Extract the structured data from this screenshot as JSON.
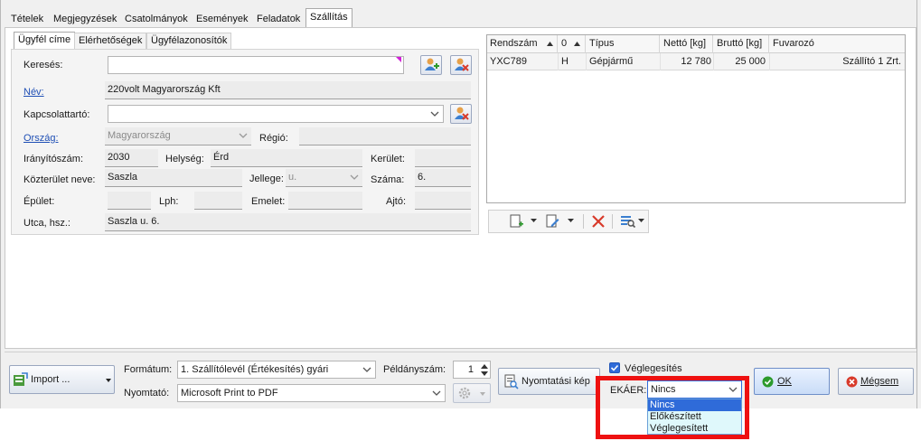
{
  "main_tabs": [
    "Tételek",
    "Megjegyzések",
    "Csatolmányok",
    "Események",
    "Feladatok",
    "Szállítás"
  ],
  "sub_tabs": [
    "Ügyfél címe",
    "Elérhetőségek",
    "Ügyfélazonosítók"
  ],
  "address": {
    "search_label": "Keresés:",
    "search_value": "",
    "name_label": "Név:",
    "name_value": "220volt Magyarország Kft",
    "contact_label": "Kapcsolattartó:",
    "contact_value": "",
    "country_label": "Ország:",
    "country_value": "Magyarország",
    "region_label": "Régió:",
    "region_value": "",
    "zip_label": "Irányítószám:",
    "zip_value": "2030",
    "city_label": "Helység:",
    "city_value": "Érd",
    "district_label": "Kerület:",
    "district_value": "",
    "street_label": "Közterület neve:",
    "street_value": "Saszla",
    "type_label": "Jellege:",
    "type_value": "u.",
    "number_label": "Száma:",
    "number_value": "6.",
    "building_label": "Épület:",
    "building_value": "",
    "stairs_label": "Lph:",
    "stairs_value": "",
    "floor_label": "Emelet:",
    "floor_value": "",
    "door_label": "Ajtó:",
    "door_value": "",
    "full_label": "Utca, hsz.:",
    "full_value": "Saszla u. 6."
  },
  "vehicle_grid": {
    "columns": [
      "Rendszám",
      "0",
      "Típus",
      "Nettó [kg]",
      "Bruttó [kg]",
      "Fuvarozó"
    ],
    "rows": [
      [
        "YXC789",
        "H",
        "Gépjármű",
        "12 780",
        "25 000",
        "Szállító 1 Zrt."
      ]
    ]
  },
  "footer": {
    "import_label": "Import ...",
    "format_label": "Formátum:",
    "format_value": "1. Szállítólevél (Értékesítés) gyári",
    "copies_label": "Példányszám:",
    "copies_value": "1",
    "printer_label": "Nyomtató:",
    "printer_value": "Microsoft Print to PDF",
    "print_image_label": "Nyomtatási kép",
    "finalize_label": "Véglegesítés",
    "ekaer_label": "EKÁER:",
    "ekaer_value": "Nincs",
    "ekaer_options": [
      "Nincs",
      "Előkészített",
      "Véglegesített"
    ],
    "ok_label": "OK",
    "cancel_label": "Mégsem"
  },
  "colors": {
    "highlight_box": "#ee1111",
    "selection": "#2f6bd9",
    "list_bg": "#dff8fb",
    "link": "#1f4fb5"
  }
}
